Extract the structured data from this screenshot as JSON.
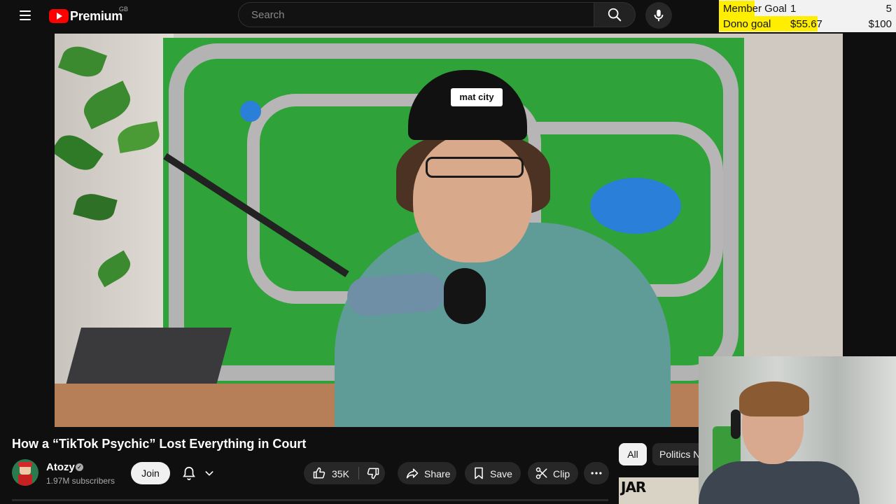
{
  "header": {
    "logo_text": "Premium",
    "region": "GB",
    "search_placeholder": "Search"
  },
  "stream_overlay": {
    "member_goal": {
      "label": "Member Goal",
      "current": "1",
      "target": "5",
      "progress": 0.2
    },
    "dono_goal": {
      "label": "Dono goal",
      "current": "$55.67",
      "target": "$100",
      "progress": 0.5567
    }
  },
  "video": {
    "cap_logo": "mat city",
    "title": "How a “TikTok Psychic” Lost Everything in Court"
  },
  "channel": {
    "name": "Atozy",
    "subscribers": "1.97M subscribers",
    "join_label": "Join"
  },
  "actions": {
    "like_count": "35K",
    "share_label": "Share",
    "save_label": "Save",
    "clip_label": "Clip"
  },
  "chips": [
    "All",
    "Politics N"
  ],
  "recommendation": {
    "thumb_text": "JAR"
  },
  "icons": [
    "menu-icon",
    "search-icon",
    "mic-icon",
    "bell-icon",
    "chevron-down-icon",
    "thumbs-up-icon",
    "thumbs-down-icon",
    "share-icon",
    "bookmark-icon",
    "scissors-icon",
    "more-horizontal-icon",
    "verified-icon"
  ],
  "colors": {
    "background": "#0f0f0f",
    "youtube_red": "#ff0000",
    "goal_fill": "#ffee00",
    "pill_bg": "#272727"
  }
}
